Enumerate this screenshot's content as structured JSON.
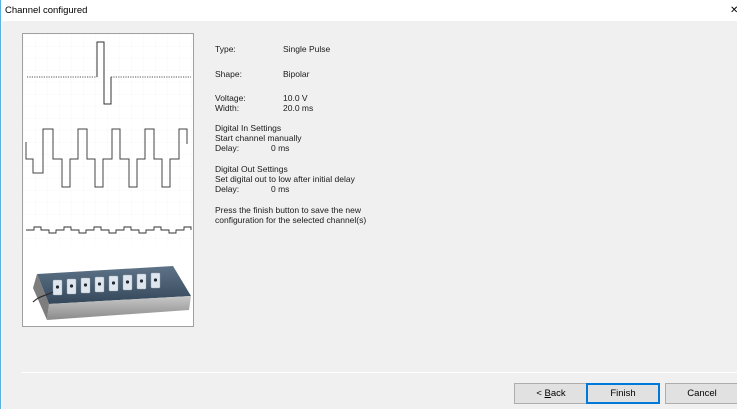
{
  "window": {
    "title": "Channel configured",
    "close_glyph": "✕"
  },
  "info": {
    "type_label": "Type:",
    "type_value": "Single Pulse",
    "shape_label": "Shape:",
    "shape_value": "Bipolar",
    "voltage_label": "Voltage:",
    "voltage_value": "10.0 V",
    "width_label": "Width:",
    "width_value": "20.0 ms",
    "digital_in_heading": "Digital In Settings",
    "digital_in_mode": "Start channel manually",
    "digital_in_delay_label": "Delay:",
    "digital_in_delay_value": "0 ms",
    "digital_out_heading": "Digital Out Settings",
    "digital_out_mode": "Set digital out to low after initial delay",
    "digital_out_delay_label": "Delay:",
    "digital_out_delay_value": "0 ms",
    "instruction_line1": "Press the finish button to save the new",
    "instruction_line2": "configuration for the selected channel(s)"
  },
  "buttons": {
    "back_prefix": "< ",
    "back_accel": "B",
    "back_rest": "ack",
    "finish": "Finish",
    "cancel": "Cancel"
  },
  "icons": {
    "waveform_illustration": "pulse-waveform-icon",
    "device_illustration": "stimulator-device-icon"
  }
}
